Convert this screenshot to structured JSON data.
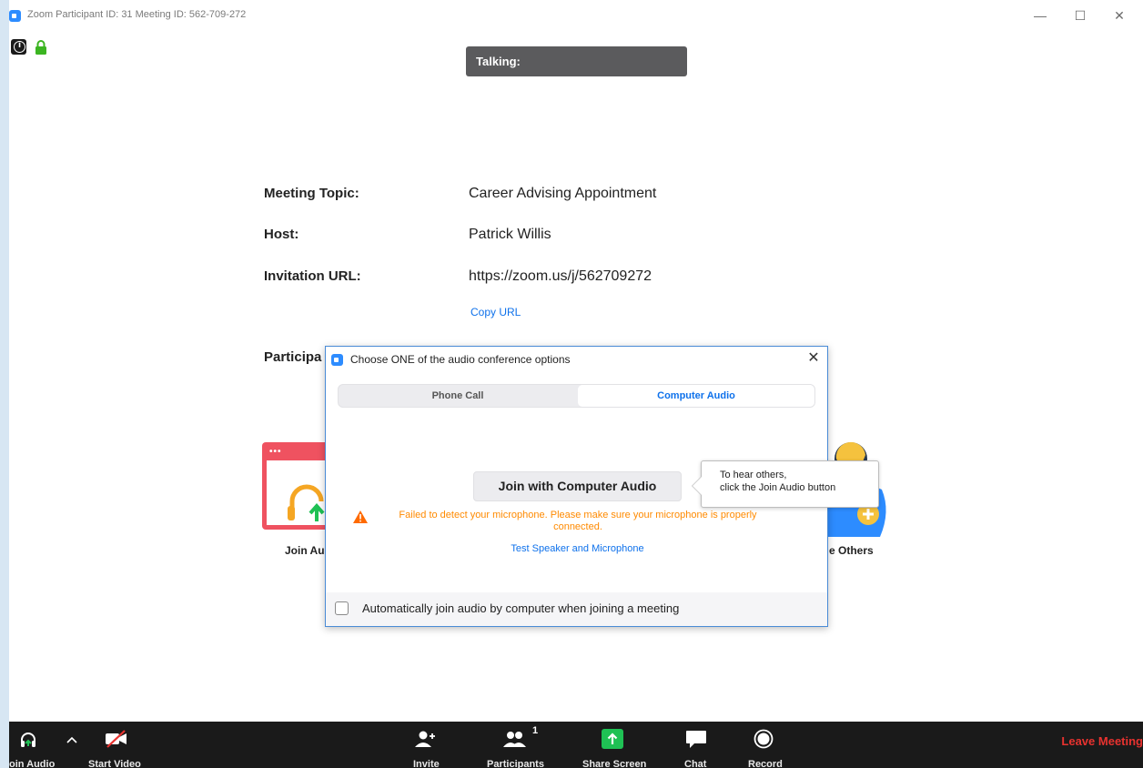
{
  "window": {
    "title": "Zoom Participant ID: 31   Meeting ID: 562-709-272",
    "controls": {
      "minimize": "—",
      "maximize": "☐",
      "close": "✕"
    }
  },
  "talking": "Talking:",
  "meeting": {
    "topic_label": "Meeting Topic:",
    "topic": "Career Advising Appointment",
    "host_label": "Host:",
    "host": "Patrick Willis",
    "url_label": "Invitation URL:",
    "url": "https://zoom.us/j/562709272",
    "copy_url": "Copy URL",
    "participants_label": "Participa"
  },
  "background_actions": {
    "join_audio": "Join Au",
    "invite_others": "e Others"
  },
  "dialog": {
    "title": "Choose ONE of the audio conference options",
    "close": "✕",
    "tabs": [
      {
        "label": "Phone Call",
        "active": false
      },
      {
        "label": "Computer Audio",
        "active": true
      }
    ],
    "join_button": "Join with Computer Audio",
    "warning": "Failed to detect your microphone. Please make sure your microphone is properly connected.",
    "test_link": "Test Speaker and Microphone",
    "auto_join_label": "Automatically join audio by computer when joining a meeting",
    "auto_join_checked": false
  },
  "tooltip": {
    "line1": "To hear others,",
    "line2": "click the Join Audio button"
  },
  "toolbar": {
    "join_audio": "oin Audio",
    "start_video": "Start Video",
    "invite": "Invite",
    "participants": "Participants",
    "participants_count": "1",
    "share_screen": "Share Screen",
    "chat": "Chat",
    "record": "Record",
    "leave": "Leave Meeting"
  },
  "colors": {
    "accent": "#0e71eb",
    "warning": "#ff8a00",
    "leave": "#e8322f",
    "share": "#1fc154",
    "toolbar_bg": "#1a1a1a"
  }
}
